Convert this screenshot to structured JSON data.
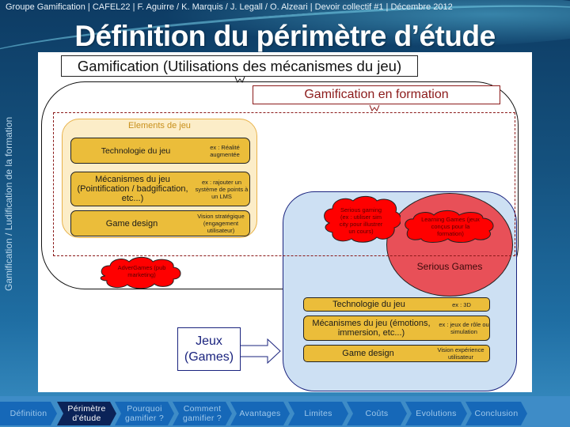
{
  "header": {
    "meta_line": "Groupe Gamification |  CAFEL22  | F. Aguirre / K. Marquis / J. Legall / O. Alzeari |  Devoir collectif #1  | Décembre 2012",
    "title": "Définition du périmètre d’étude",
    "side_label": "Gamification / Ludification de la formation"
  },
  "diagram": {
    "gamification_box": "Gamification (Utilisations des mécanismes du jeu)",
    "formation_box": "Gamification en formation",
    "elements_title": "Elements de jeu",
    "elements_rows": [
      {
        "main": "Technologie du jeu",
        "note": "ex : Réalité augmentée"
      },
      {
        "main": "Mécanismes du jeu (Pointification / badgification, etc...)",
        "note": "ex : rajouter un système de points à un LMS"
      },
      {
        "main": "Game design",
        "note": "Vision stratégique (engagement utilisateur)"
      }
    ],
    "clouds": {
      "advergames": "AdverGames (pub marketing)",
      "serious_gaming": "Serious gaming (ex : utiliser sim city pour illustrer un cours)",
      "learning_games": "Learning Games (jeux conçus pour la formation)"
    },
    "serious_games_label": "Serious Games",
    "games_rows": [
      {
        "main": "Technologie du jeu",
        "note": "ex : 3D"
      },
      {
        "main": "Mécanismes du jeu (émotions, immersion, etc...)",
        "note": "ex : jeux de rôle ou simulation"
      },
      {
        "main": "Game design",
        "note": "Vision expérience utilisateur"
      }
    ],
    "jeux_box": "Jeux (Games)"
  },
  "nav": {
    "active_index": 1,
    "tabs": [
      {
        "label": "Définition"
      },
      {
        "label": "Périmètre d'étude"
      },
      {
        "label": "Pourquoi gamifier ?"
      },
      {
        "label": "Comment gamifier ?"
      },
      {
        "label": "Avantages"
      },
      {
        "label": "Limites"
      },
      {
        "label": "Coûts"
      },
      {
        "label": "Evolutions"
      },
      {
        "label": "Conclusion"
      }
    ]
  }
}
